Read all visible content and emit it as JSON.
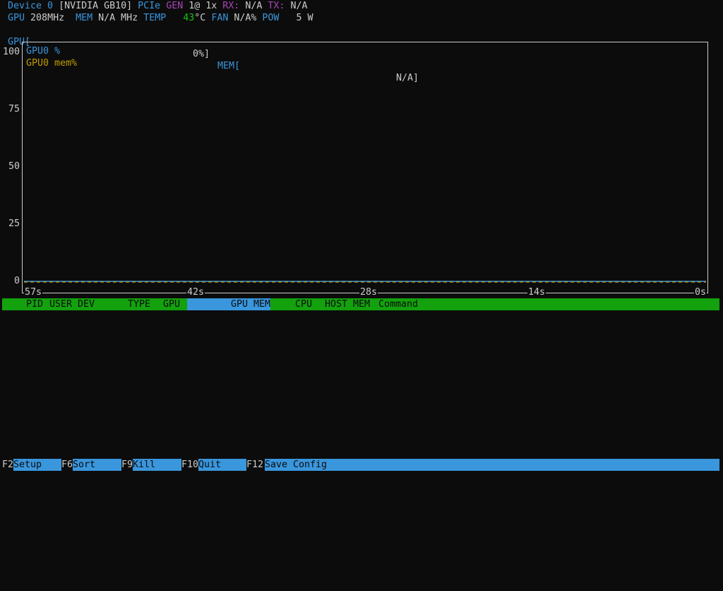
{
  "header": {
    "device_label": "Device 0",
    "device_name": "[NVIDIA GB10]",
    "pcie_label": "PCIe",
    "gen_label": "GEN",
    "gen_value": "1@ 1x",
    "rx_label": "RX:",
    "rx_value": "N/A",
    "tx_label": "TX:",
    "tx_value": "N/A",
    "gpu_label": "GPU",
    "gpu_clock": "208MHz",
    "mem_label": "MEM",
    "mem_clock": "N/A MHz",
    "temp_label": "TEMP",
    "temp_value": "43",
    "temp_unit": "°C",
    "fan_label": "FAN",
    "fan_value": "N/A%",
    "pow_label": "POW",
    "pow_value": "5 W",
    "gpu_bar_label": "GPU[",
    "gpu_bar_value": "0%]",
    "mem_bar_label": "MEM[",
    "mem_bar_value": "N/A]"
  },
  "chart": {
    "y_ticks": [
      "100",
      "75",
      "50",
      "25",
      "0"
    ],
    "x_ticks": [
      "57s",
      "42s",
      "28s",
      "14s",
      "0s"
    ],
    "legend": [
      {
        "name": "GPU0 %",
        "color": "#3a96dd"
      },
      {
        "name": "GPU0 mem%",
        "color": "#c19c00"
      }
    ],
    "series_values": {
      "gpu_util": 0,
      "gpu_mem": 0
    }
  },
  "table": {
    "columns": [
      "PID",
      "USER",
      "DEV",
      "TYPE",
      "GPU",
      "GPU MEM",
      "CPU",
      "HOST MEM",
      "Command"
    ],
    "sorted_column": "GPU MEM"
  },
  "footer": [
    {
      "key": "F2",
      "label": "Setup"
    },
    {
      "key": "F6",
      "label": "Sort"
    },
    {
      "key": "F9",
      "label": "Kill"
    },
    {
      "key": "F10",
      "label": "Quit"
    },
    {
      "key": "F12",
      "label": "Save Config"
    }
  ]
}
